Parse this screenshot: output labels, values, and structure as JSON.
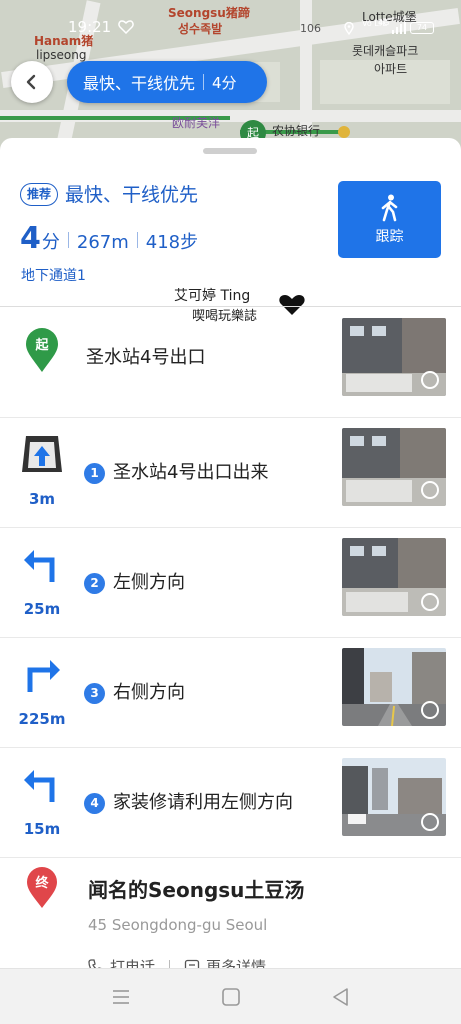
{
  "status_bar": {
    "time": "19:21",
    "network_volte": "Vo LTE",
    "network_type": "4G",
    "battery": "74"
  },
  "map": {
    "labels": [
      {
        "text": "Seongsu猪蹄",
        "cls": "lbl red"
      },
      {
        "text": "성수족발",
        "cls": "lbl red"
      },
      {
        "text": "Hanam猪",
        "cls": "lbl red"
      },
      {
        "text": "lipseong",
        "cls": "lbl dark"
      },
      {
        "text": "Lotte城堡",
        "cls": "lbl dark"
      },
      {
        "text": "롯데캐슬파크",
        "cls": "lbl dark"
      },
      {
        "text": "아파트",
        "cls": "lbl dark"
      },
      {
        "text": "欧耐芙洋",
        "cls": "lbl purple"
      },
      {
        "text": "农协银行",
        "cls": "lbl dark"
      },
      {
        "text": "106",
        "cls": "lbl mid"
      }
    ],
    "badge": "起"
  },
  "header": {
    "route_pill": "最快、干线优先",
    "route_minutes": "4分"
  },
  "summary": {
    "tag": "推荐",
    "route_name": "最快、干线优先",
    "duration_value": "4",
    "duration_unit": "分",
    "distance": "267m",
    "steps": "418步",
    "exit_name": "地下通道1",
    "track_button": "跟踪"
  },
  "watermark": {
    "line1": "艾可婷 Ting",
    "line2": "喫喝玩樂誌"
  },
  "steps": [
    {
      "type": "start",
      "badge": "起",
      "text": "圣水站4号出口"
    },
    {
      "type": "exit",
      "number": "1",
      "text": "圣水站4号出口出来",
      "distance": "3m"
    },
    {
      "type": "turn-left",
      "number": "2",
      "text": "左侧方向",
      "distance": "25m"
    },
    {
      "type": "turn-right",
      "number": "3",
      "text": "右侧方向",
      "distance": "225m"
    },
    {
      "type": "turn-left",
      "number": "4",
      "text": "家装修请利用左侧方向",
      "distance": "15m"
    }
  ],
  "destination": {
    "badge": "终",
    "name": "闻名的Seongsu土豆汤",
    "address": "45 Seongdong-gu Seoul",
    "call": "打电话",
    "more": "更多详情"
  },
  "colors": {
    "accent": "#1f74e8",
    "accent_text": "#1f5fc7",
    "start_green": "#2f9a48",
    "end_red": "#e0464a"
  },
  "icons": [
    "back-arrow-icon",
    "walk-icon",
    "start-pin-icon",
    "exit-stairs-icon",
    "turn-left-icon",
    "turn-right-icon",
    "end-pin-icon",
    "phone-icon",
    "info-icon",
    "menu-nav-icon",
    "home-nav-icon",
    "back-nav-icon"
  ]
}
